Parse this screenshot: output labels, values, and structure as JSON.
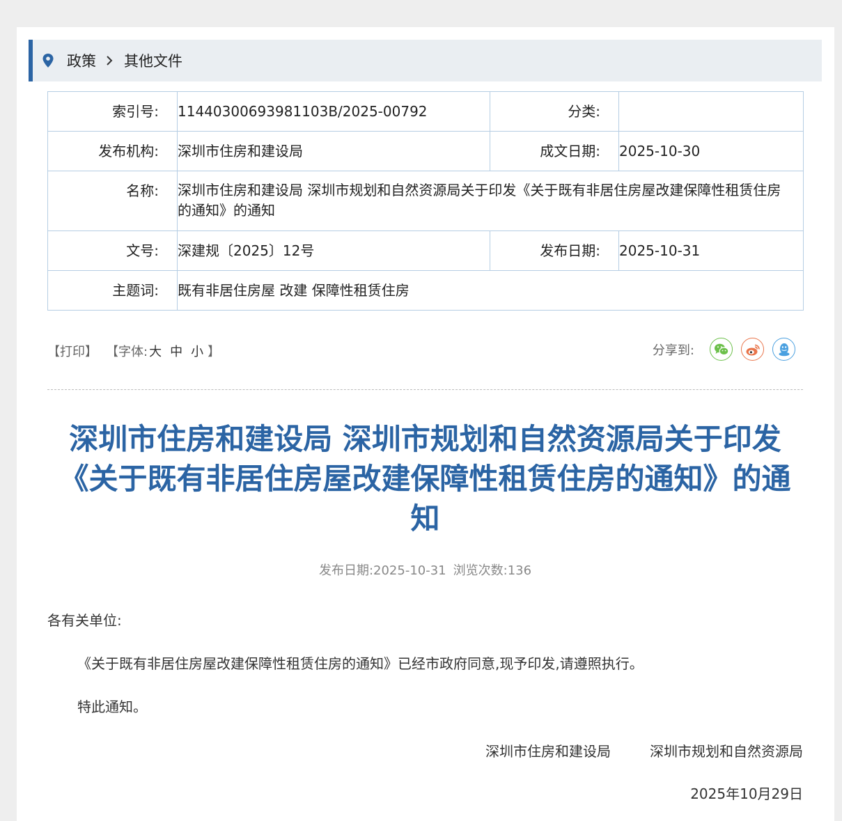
{
  "breadcrumb": {
    "items": [
      "政策",
      "其他文件"
    ]
  },
  "info": {
    "index_label": "索引号:",
    "index_value": "11440300693981103B/2025-00792",
    "category_label": "分类:",
    "category_value": "",
    "publisher_label": "发布机构:",
    "publisher_value": "深圳市住房和建设局",
    "written_date_label": "成文日期:",
    "written_date_value": "2025-10-30",
    "name_label": "名称:",
    "name_value": "深圳市住房和建设局 深圳市规划和自然资源局关于印发《关于既有非居住房屋改建保障性租赁住房的通知》的通知",
    "doc_no_label": "文号:",
    "doc_no_value": "深建规〔2025〕12号",
    "publish_date_label": "发布日期:",
    "publish_date_value": "2025-10-31",
    "keywords_label": "主题词:",
    "keywords_value": "既有非居住房屋 改建 保障性租赁住房"
  },
  "tools": {
    "open_bracket": "【",
    "print": "打印",
    "close_bracket": "】",
    "font_open": "【字体:",
    "font_large": "大",
    "font_medium": "中",
    "font_small": "小",
    "font_close": "】"
  },
  "share": {
    "label": "分享到:",
    "targets": [
      "wechat",
      "weibo",
      "qq"
    ]
  },
  "colors": {
    "accent": "#2b64a4",
    "wechat": "#6cc04a",
    "weibo": "#e9744a",
    "qq": "#4aa0e0"
  },
  "article": {
    "title": "深圳市住房和建设局 深圳市规划和自然资源局关于印发《关于既有非居住房屋改建保障性租赁住房的通知》的通知",
    "publish_date": "发布日期:2025-10-31",
    "view_count": "浏览次数:136",
    "greeting": "各有关单位:",
    "paragraph1": "《关于既有非居住房屋改建保障性租赁住房的通知》已经市政府同意,现予印发,请遵照执行。",
    "paragraph2": "特此通知。",
    "signer1": "深圳市住房和建设局",
    "signer2": "深圳市规划和自然资源局",
    "date": "2025年10月29日"
  }
}
